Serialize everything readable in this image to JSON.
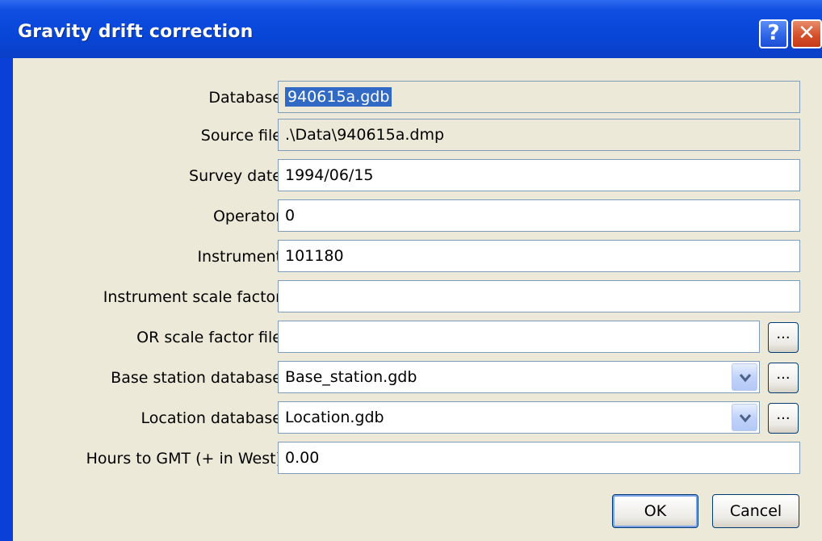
{
  "window": {
    "title": "Gravity drift correction",
    "help_label": "?",
    "close_label": "✕"
  },
  "fields": {
    "database": {
      "label": "Database",
      "value": "940615a.gdb"
    },
    "source_file": {
      "label": "Source file",
      "value": ".\\Data\\940615a.dmp"
    },
    "survey_date": {
      "label": "Survey date",
      "value": "1994/06/15"
    },
    "operator": {
      "label": "Operator",
      "value": "0"
    },
    "instrument": {
      "label": "Instrument",
      "value": "101180"
    },
    "instrument_scale_factor": {
      "label": "Instrument scale factor",
      "value": ""
    },
    "scale_factor_file": {
      "label": "OR scale factor file",
      "value": ""
    },
    "base_station_database": {
      "label": "Base station database",
      "value": "Base_station.gdb"
    },
    "location_database": {
      "label": "Location database",
      "value": "Location.gdb"
    },
    "hours_to_gmt": {
      "label": "Hours to GMT (+ in West)",
      "value": "0.00"
    }
  },
  "browse_label": "...",
  "buttons": {
    "ok": "OK",
    "cancel": "Cancel"
  },
  "colors": {
    "titlebar": "#0846d8",
    "dialog_bg": "#ece9d8",
    "selection": "#316ac5"
  }
}
